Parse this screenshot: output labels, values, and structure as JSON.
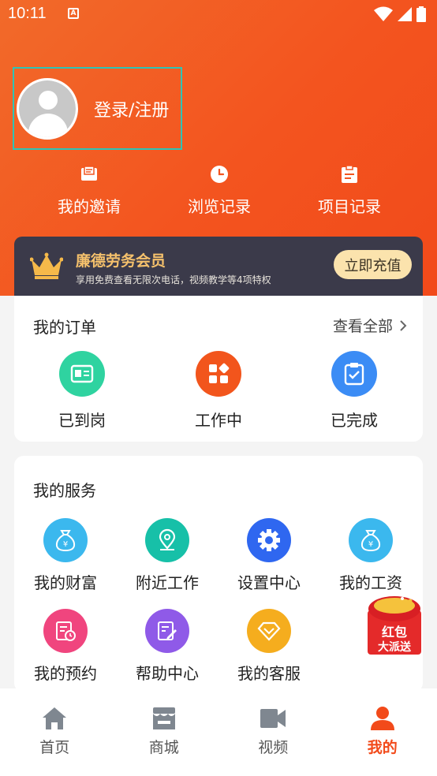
{
  "status_bar": {
    "time": "10:11",
    "notif_glyph": "A"
  },
  "profile": {
    "login_label": "登录/注册"
  },
  "quick_links": [
    {
      "label": "我的邀请",
      "icon": "envelope-icon"
    },
    {
      "label": "浏览记录",
      "icon": "clock-icon"
    },
    {
      "label": "项目记录",
      "icon": "clipboard-icon"
    }
  ],
  "vip": {
    "title": "廉德劳务会员",
    "subtitle": "享用免费查看无限次电话，视频教学等4项特权",
    "button": "立即充值"
  },
  "orders": {
    "title": "我的订单",
    "see_all": "查看全部",
    "items": [
      {
        "label": "已到岗",
        "icon": "id-card-icon",
        "color": "#2fd3a0"
      },
      {
        "label": "工作中",
        "icon": "apps-icon",
        "color": "#f2551c"
      },
      {
        "label": "已完成",
        "icon": "clipboard-check-icon",
        "color": "#3b8cf5"
      }
    ]
  },
  "services": {
    "title": "我的服务",
    "items": [
      {
        "label": "我的财富",
        "icon": "money-bag-icon",
        "color": "#3bb8ee"
      },
      {
        "label": "附近工作",
        "icon": "location-pin-icon",
        "color": "#17c0a8"
      },
      {
        "label": "设置中心",
        "icon": "gear-icon",
        "color": "#2f67f0"
      },
      {
        "label": "我的工资",
        "icon": "money-bag-icon",
        "color": "#3bb8ee"
      },
      {
        "label": "我的预约",
        "icon": "calendar-clock-icon",
        "color": "#f0457e"
      },
      {
        "label": "帮助中心",
        "icon": "edit-doc-icon",
        "color": "#8f5ae8"
      },
      {
        "label": "我的客服",
        "icon": "diamond-icon",
        "color": "#f5ad1e"
      }
    ]
  },
  "red_packet": {
    "line1": "红包",
    "line2": "大派送"
  },
  "tabbar": [
    {
      "label": "首页",
      "icon": "home-icon",
      "active": false
    },
    {
      "label": "商城",
      "icon": "store-icon",
      "active": false
    },
    {
      "label": "视频",
      "icon": "video-icon",
      "active": false
    },
    {
      "label": "我的",
      "icon": "user-icon",
      "active": true
    }
  ],
  "colors": {
    "accent": "#f24a1a",
    "vip_gold": "#f5c16c",
    "vip_bg": "#3b3a4a"
  }
}
